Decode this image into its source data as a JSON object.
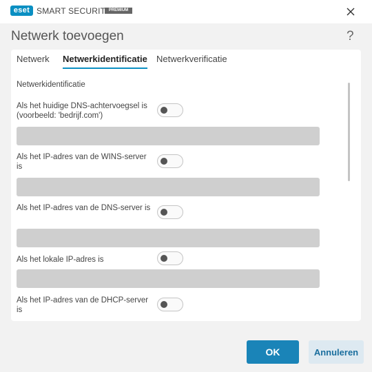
{
  "window": {
    "logo_text": "eset",
    "product_name": "SMART SECURITY",
    "edition_badge": "PREMIUM",
    "close_icon": "close-icon"
  },
  "dialog": {
    "title": "Netwerk toevoegen",
    "help_label": "?"
  },
  "tabs": [
    {
      "label": "Netwerk",
      "active": false
    },
    {
      "label": "Netwerkidentificatie",
      "active": true
    },
    {
      "label": "Netwerkverificatie",
      "active": false
    }
  ],
  "section_title": "Netwerkidentificatie",
  "rows": [
    {
      "label": "Als het huidige DNS-achtervoegsel is (voorbeeld: 'bedrijf.com')",
      "enabled": false,
      "value": ""
    },
    {
      "label": "Als het IP-adres van de WINS-server is",
      "enabled": false,
      "value": ""
    },
    {
      "label": "Als het IP-adres van de DNS-server is",
      "enabled": false,
      "value": ""
    },
    {
      "label": "Als het lokale IP-adres is",
      "enabled": false,
      "value": ""
    },
    {
      "label": "Als het IP-adres van de DHCP-server is",
      "enabled": false,
      "value": ""
    }
  ],
  "buttons": {
    "ok_label": "OK",
    "cancel_label": "Annuleren"
  },
  "colors": {
    "accent": "#0a8fc2",
    "primary_button": "#1a84b8",
    "secondary_button": "#dde9f1",
    "field_disabled": "#cfcfcf"
  }
}
